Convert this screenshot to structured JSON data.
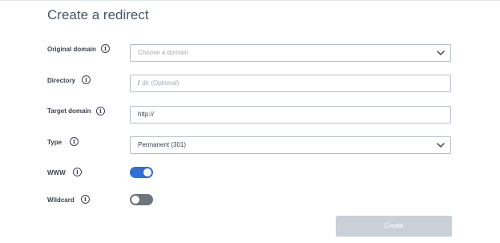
{
  "page": {
    "title": "Create a redirect"
  },
  "form": {
    "original_domain": {
      "label": "Original domain",
      "placeholder": "Choose a domain"
    },
    "directory": {
      "label": "Directory",
      "prefix": "/",
      "placeholder": "dir (Optional)"
    },
    "target_domain": {
      "label": "Target domain",
      "value": "http://"
    },
    "type": {
      "label": "Type",
      "value": "Permanent (301)"
    },
    "www": {
      "label": "WWW",
      "enabled": true
    },
    "wildcard": {
      "label": "Wildcard",
      "enabled": false
    },
    "info_glyph": "i",
    "create_label": "Create"
  },
  "colors": {
    "toggle_on": "#2f6fd6",
    "toggle_off": "#6e747b",
    "button_disabled": "#c9d0d8"
  },
  "icons": [
    "info-icon",
    "chevron-down-icon"
  ]
}
